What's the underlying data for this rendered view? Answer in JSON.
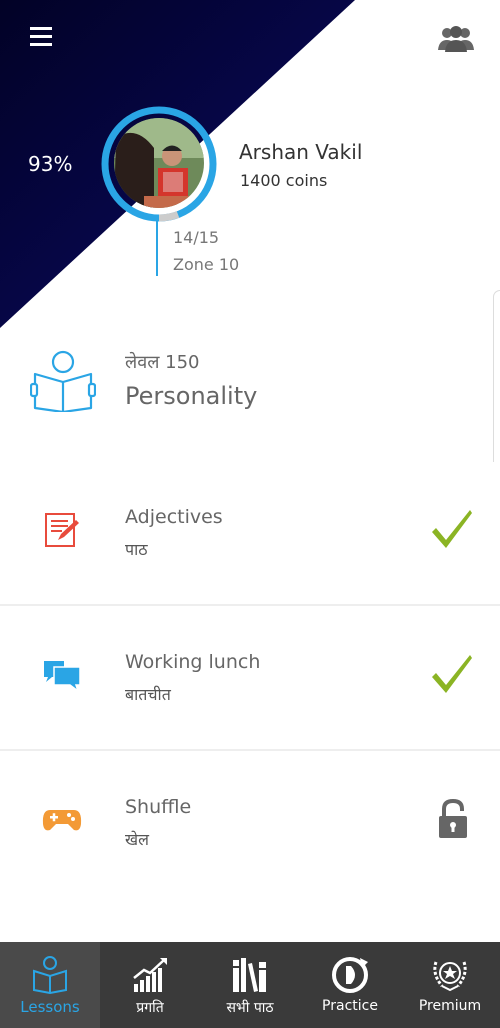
{
  "header": {
    "progress_percent": "93%",
    "user_name": "Arshan Vakil",
    "coins": "1400 coins",
    "lesson_progress": "14/15",
    "zone": "Zone 10"
  },
  "level": {
    "label": "लेवल 150",
    "title": "Personality"
  },
  "lessons": [
    {
      "title": "Adjectives",
      "subtitle": "पाठ",
      "icon": "notebook-pencil-icon",
      "status": "completed"
    },
    {
      "title": "Working lunch",
      "subtitle": "बातचीत",
      "icon": "chat-bubbles-icon",
      "status": "completed"
    },
    {
      "title": "Shuffle",
      "subtitle": "खेल",
      "icon": "gamepad-icon",
      "status": "locked"
    }
  ],
  "nav": {
    "items": [
      {
        "label": "Lessons",
        "icon": "book-reader-icon",
        "active": true
      },
      {
        "label": "प्रगति",
        "icon": "bar-chart-icon",
        "active": false
      },
      {
        "label": "सभी पाठ",
        "icon": "books-icon",
        "active": false
      },
      {
        "label": "Practice",
        "icon": "practice-icon",
        "active": false
      },
      {
        "label": "Premium",
        "icon": "laurel-star-icon",
        "active": false
      }
    ]
  },
  "colors": {
    "accent": "#2aa5e5",
    "header_dark": "#060633",
    "check": "#8bb424",
    "nav_bg": "#3a3a3a"
  }
}
